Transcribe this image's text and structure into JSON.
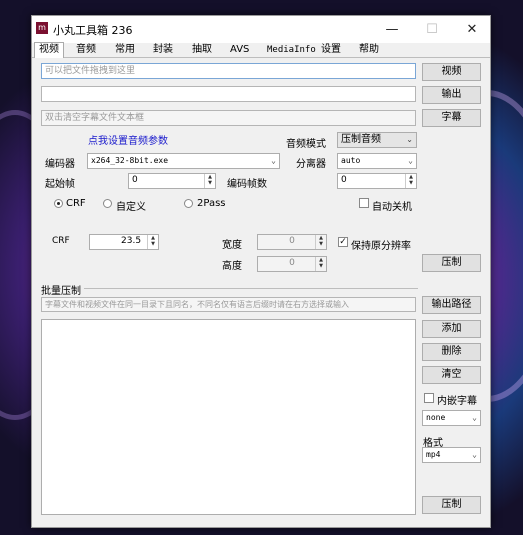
{
  "window": {
    "title": "小丸工具箱 236",
    "icon": "app-logo-icon"
  },
  "titlebar_buttons": {
    "minimize": "—",
    "maximize": "☐",
    "close": "✕"
  },
  "tabs": [
    "视频",
    "音频",
    "常用",
    "封装",
    "抽取",
    "AVS",
    "MediaInfo",
    "设置",
    "帮助"
  ],
  "video": {
    "video_input_placeholder": "可以把文件拖拽到这里",
    "video_button": "视频",
    "output_button": "输出",
    "subtitle_input_placeholder": "双击清空字幕文件文本框",
    "subtitle_button": "字幕",
    "audio_link": "点我设置音频参数",
    "audio_mode_label": "音频模式",
    "audio_mode_value": "压制音频",
    "encoder_label": "编码器",
    "encoder_value": "x264_32-8bit.exe",
    "demuxer_label": "分离器",
    "demuxer_value": "auto",
    "start_frame_label": "起始帧",
    "start_frame_value": "0",
    "frame_count_label": "编码帧数",
    "frame_count_value": "0",
    "mode_crf": "CRF",
    "mode_custom": "自定义",
    "mode_2pass": "2Pass",
    "auto_shutdown_label": "自动关机",
    "crf_label": "CRF",
    "crf_value": "23.5",
    "width_label": "宽度",
    "width_value": "0",
    "height_label": "高度",
    "height_value": "0",
    "keep_resolution_label": "保持原分辨率",
    "encode_button": "压制"
  },
  "batch": {
    "section_label": "批量压制",
    "hint_placeholder": "字幕文件和视频文件在同一目录下且同名，不同名仅有语言后缀时请在右方选择或输入",
    "output_path_button": "输出路径",
    "add_button": "添加",
    "delete_button": "删除",
    "clear_button": "清空",
    "embed_subtitle_label": "内嵌字幕",
    "subtitle_select_value": "none",
    "format_label": "格式",
    "format_value": "mp4",
    "encode_button": "压制"
  }
}
